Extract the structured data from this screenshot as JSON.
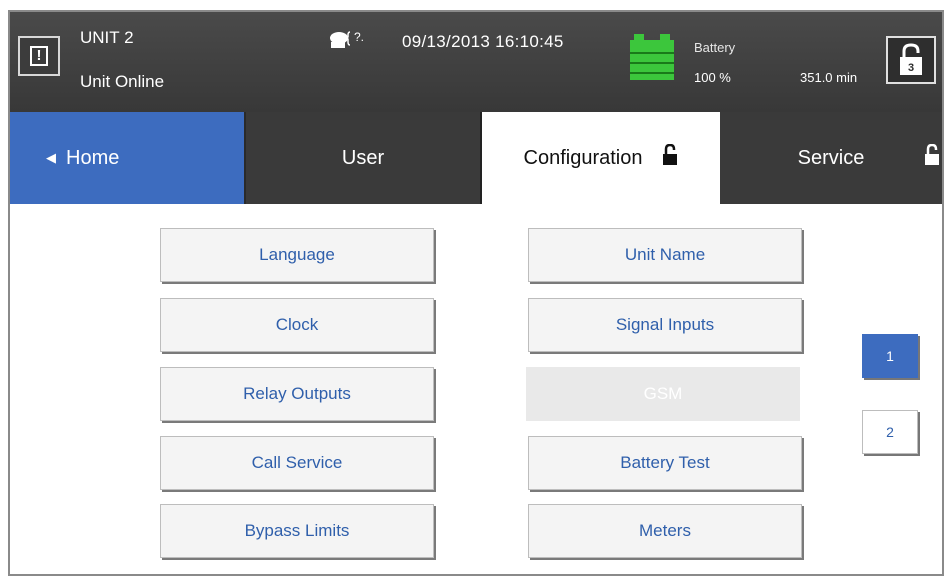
{
  "header": {
    "unit_name": "UNIT 2",
    "unit_status": "Unit Online",
    "alarm_glyph": "!",
    "datetime": "09/13/2013 16:10:45",
    "battery_label": "Battery",
    "battery_percent": "100 %",
    "battery_runtime": "351.0 min",
    "lock_icon": "padlock-open-icon",
    "lock_badge": "3"
  },
  "tabs": {
    "home": "Home",
    "user": "User",
    "configuration": "Configuration",
    "service": "Service"
  },
  "buttons": {
    "language": "Language",
    "unit_name": "Unit Name",
    "clock": "Clock",
    "signal_inputs": "Signal Inputs",
    "relay_outputs": "Relay Outputs",
    "gsm": "GSM",
    "call_service": "Call Service",
    "battery_test": "Battery Test",
    "bypass_limits": "Bypass Limits",
    "meters": "Meters"
  },
  "pagination": {
    "page1": "1",
    "page2": "2"
  },
  "colors": {
    "accent_blue": "#3d6cbf",
    "battery_green": "#3cc63c",
    "button_text": "#2f5fab",
    "header_bg": "#404040"
  }
}
